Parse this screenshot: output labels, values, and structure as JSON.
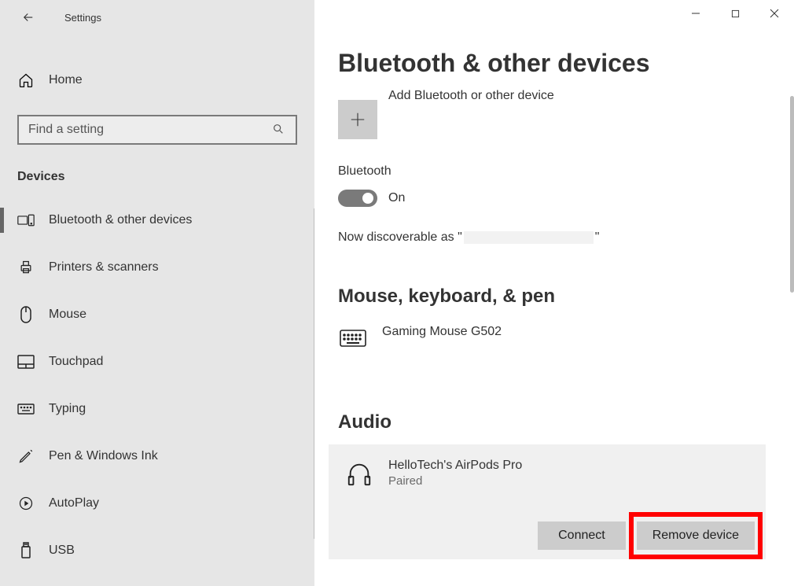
{
  "window": {
    "title": "Settings"
  },
  "sidebar": {
    "home_label": "Home",
    "search_placeholder": "Find a setting",
    "category_label": "Devices",
    "items": [
      {
        "label": "Bluetooth & other devices",
        "icon": "devices-icon",
        "active": true
      },
      {
        "label": "Printers & scanners",
        "icon": "printer-icon",
        "active": false
      },
      {
        "label": "Mouse",
        "icon": "mouse-icon",
        "active": false
      },
      {
        "label": "Touchpad",
        "icon": "touchpad-icon",
        "active": false
      },
      {
        "label": "Typing",
        "icon": "keyboard-icon",
        "active": false
      },
      {
        "label": "Pen & Windows Ink",
        "icon": "pen-icon",
        "active": false
      },
      {
        "label": "AutoPlay",
        "icon": "autoplay-icon",
        "active": false
      },
      {
        "label": "USB",
        "icon": "usb-icon",
        "active": false
      }
    ]
  },
  "main": {
    "page_title": "Bluetooth & other devices",
    "add_device_label": "Add Bluetooth or other device",
    "bluetooth": {
      "label": "Bluetooth",
      "state": "On",
      "discoverable_prefix": "Now discoverable as \"",
      "discoverable_suffix": "\""
    },
    "sections": {
      "mkb": {
        "header": "Mouse, keyboard, & pen",
        "devices": [
          {
            "name": "Gaming Mouse G502",
            "icon": "keyboard"
          }
        ]
      },
      "audio": {
        "header": "Audio",
        "devices": [
          {
            "name": "HelloTech's AirPods Pro",
            "status": "Paired",
            "icon": "headphones"
          }
        ],
        "connect_label": "Connect",
        "remove_label": "Remove device"
      }
    }
  }
}
